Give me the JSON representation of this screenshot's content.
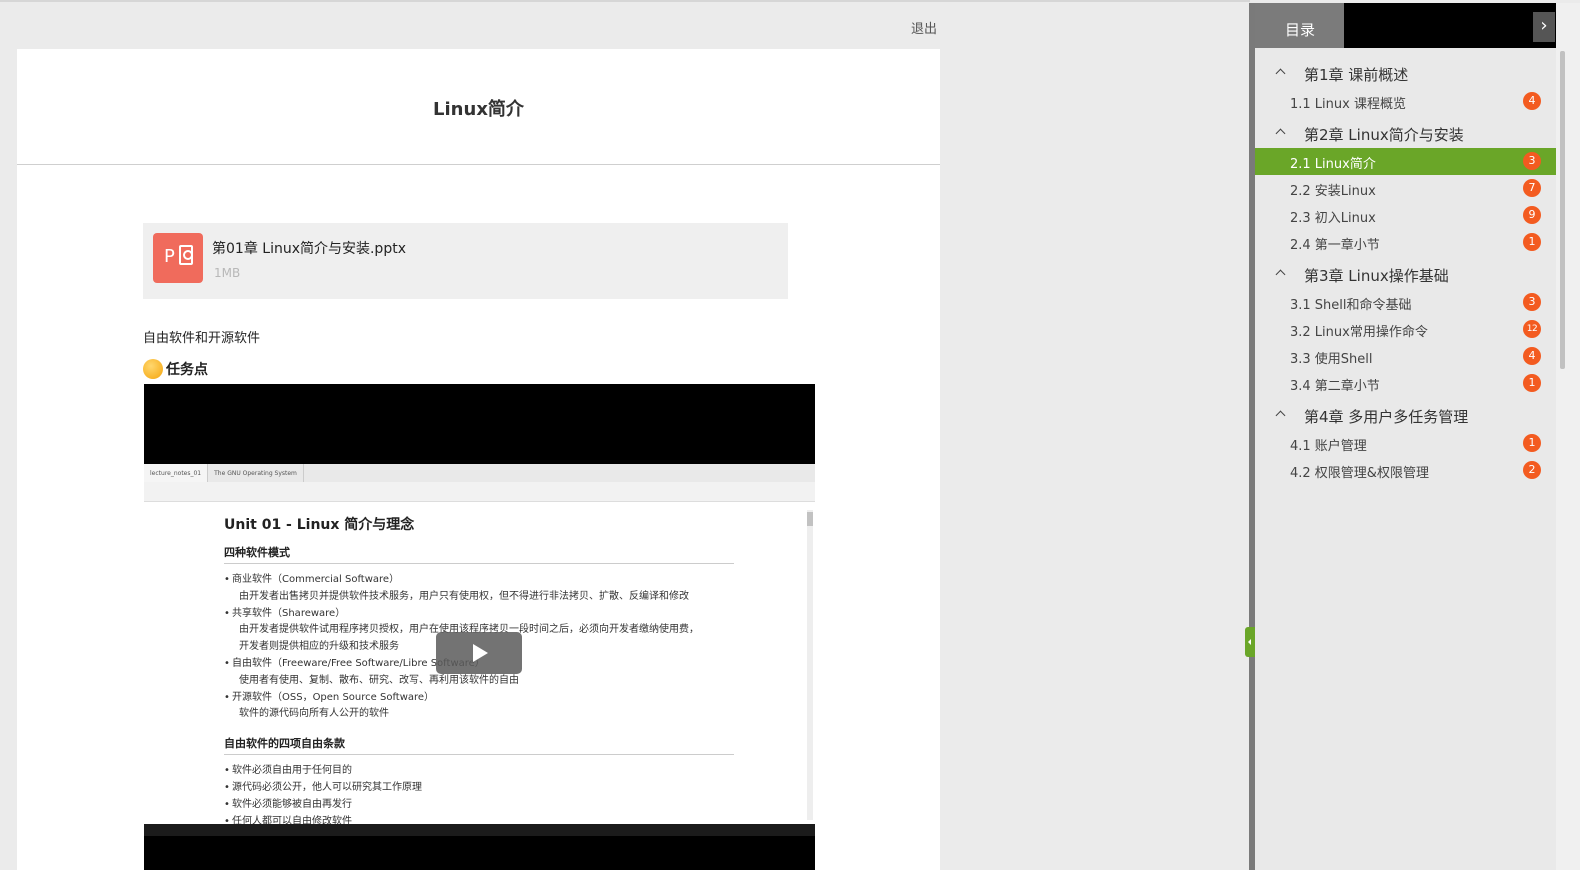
{
  "header": {
    "logout_label": "退出"
  },
  "page": {
    "title": "Linux简介"
  },
  "attachment": {
    "file_name": "第01章 Linux简介与安装.pptx",
    "file_size": "1MB"
  },
  "content": {
    "section_text": "自由软件和开源软件",
    "task_label": "任务点"
  },
  "video": {
    "tabs": [
      "lecture_notes_01",
      "The GNU Operating System"
    ],
    "heading": "Unit 01 - Linux 简介与理念",
    "section1_title": "四种软件模式",
    "section1_lines": [
      "商业软件（Commercial Software）",
      "由开发者出售拷贝并提供软件技术服务，用户只有使用权，但不得进行非法拷贝、扩散、反编译和修改",
      "共享软件（Shareware）",
      "由开发者提供软件试用程序拷贝授权，用户在使用该程序拷贝一段时间之后，必须向开发者缴纳使用费，",
      "开发者则提供相应的升级和技术服务",
      "自由软件（Freeware/Free Software/Libre Software）",
      "使用者有使用、复制、散布、研究、改写、再利用该软件的自由",
      "开源软件（OSS，Open Source Software）",
      "软件的源代码向所有人公开的软件"
    ],
    "section2_title": "自由软件的四项自由条款",
    "section2_lines": [
      "软件必须自由用于任何目的",
      "源代码必须公开，他人可以研究其工作原理",
      "软件必须能够被自由再发行",
      "任何人都可以自由修改软件"
    ]
  },
  "sidebar": {
    "tab_label": "目录",
    "toggle_icon": "›",
    "chapters": [
      {
        "title": "第1章 课前概述",
        "items": [
          {
            "label": "1.1 Linux 课程概览",
            "badge": "4"
          }
        ]
      },
      {
        "title": "第2章 Linux简介与安装",
        "items": [
          {
            "label": "2.1 Linux简介",
            "badge": "3"
          },
          {
            "label": "2.2 安装Linux",
            "badge": "7"
          },
          {
            "label": "2.3 初入Linux",
            "badge": "9"
          },
          {
            "label": "2.4 第一章小节",
            "badge": "1"
          }
        ]
      },
      {
        "title": "第3章 Linux操作基础",
        "items": [
          {
            "label": "3.1 Shell和命令基础",
            "badge": "3"
          },
          {
            "label": "3.2 Linux常用操作命令",
            "badge": "12"
          },
          {
            "label": "3.3 使用Shell",
            "badge": "4"
          },
          {
            "label": "3.4 第二章小节",
            "badge": "1"
          }
        ]
      },
      {
        "title": "第4章 多用户多任务管理",
        "items": [
          {
            "label": "4.1 账户管理",
            "badge": "1"
          },
          {
            "label": "4.2 权限管理&权限管理",
            "badge": "2"
          }
        ]
      }
    ]
  },
  "colors": {
    "accent_green": "#6aa628",
    "badge_orange": "#f35b20",
    "ppt_red": "#f06b5c"
  }
}
